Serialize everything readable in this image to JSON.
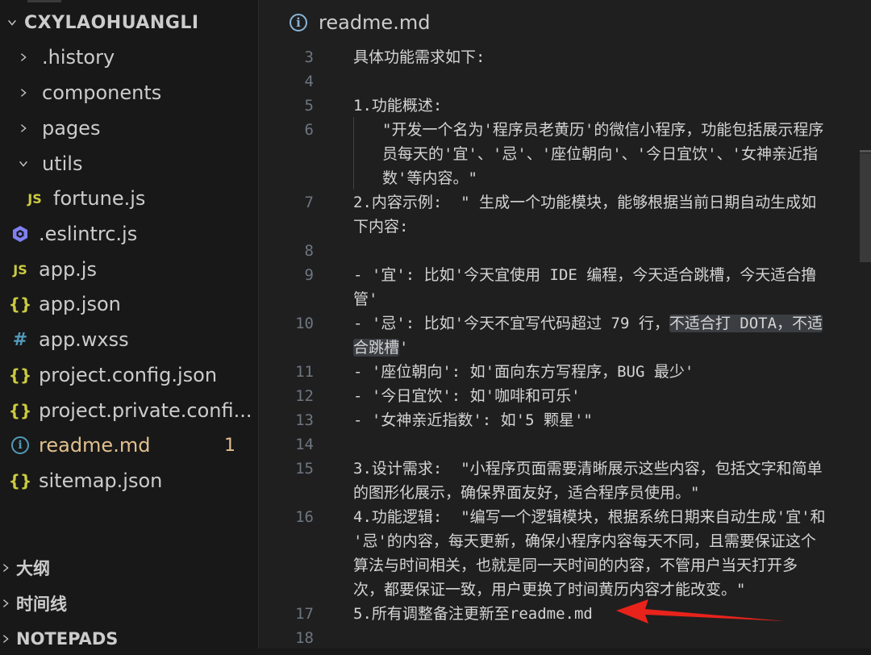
{
  "explorer": {
    "root": "CXYLAOHUANGLI",
    "items": [
      {
        "type": "folder",
        "label": ".history",
        "expanded": false
      },
      {
        "type": "folder",
        "label": "components",
        "expanded": false
      },
      {
        "type": "folder",
        "label": "pages",
        "expanded": false
      },
      {
        "type": "folder",
        "label": "utils",
        "expanded": true
      },
      {
        "type": "js",
        "label": "fortune.js"
      },
      {
        "type": "eslint",
        "label": ".eslintrc.js"
      },
      {
        "type": "js",
        "label": "app.js"
      },
      {
        "type": "json",
        "label": "app.json"
      },
      {
        "type": "css",
        "label": "app.wxss"
      },
      {
        "type": "json",
        "label": "project.config.json"
      },
      {
        "type": "json",
        "label": "project.private.confi..."
      },
      {
        "type": "info",
        "label": "readme.md",
        "badge": "1"
      },
      {
        "type": "json",
        "label": "sitemap.json"
      }
    ],
    "sections": [
      "大纲",
      "时间线",
      "NOTEPADS"
    ],
    "icons": {
      "js": "JS",
      "json": "{}",
      "css": "#",
      "info": "i"
    }
  },
  "editor": {
    "tab_title": "readme.md",
    "lines": [
      {
        "n": "3",
        "text": "具体功能需求如下:"
      },
      {
        "n": "4",
        "text": ""
      },
      {
        "n": "5",
        "text": "1.功能概述:"
      },
      {
        "n": "6",
        "text": "\"开发一个名为'程序员老黄历'的微信小程序，功能包括展示程序"
      },
      {
        "n": "",
        "text": "员每天的'宜'、'忌'、'座位朝向'、'今日宜饮'、'女神亲近指"
      },
      {
        "n": "",
        "text": "数'等内容。\""
      },
      {
        "n": "7",
        "text": "2.内容示例:  \" 生成一个功能模块，能够根据当前日期自动生成如"
      },
      {
        "n": "",
        "text": "下内容:"
      },
      {
        "n": "8",
        "text": ""
      },
      {
        "n": "9",
        "text": "- '宜': 比如'今天宜使用 IDE 编程，今天适合跳槽，今天适合撸"
      },
      {
        "n": "",
        "text": "管'"
      },
      {
        "n": "10",
        "text": "- '忌': 比如'今天不宜写代码超过 79 行，不适合打 DOTA，不适"
      },
      {
        "n": "",
        "text": "合跳槽'"
      },
      {
        "n": "11",
        "text": "- '座位朝向': 如'面向东方写程序，BUG 最少'"
      },
      {
        "n": "12",
        "text": "- '今日宜饮': 如'咖啡和可乐'"
      },
      {
        "n": "13",
        "text": "- '女神亲近指数': 如'5 颗星'\""
      },
      {
        "n": "14",
        "text": ""
      },
      {
        "n": "15",
        "text": "3.设计需求:  \"小程序页面需要清晰展示这些内容，包括文字和简单"
      },
      {
        "n": "",
        "text": "的图形化展示，确保界面友好，适合程序员使用。\""
      },
      {
        "n": "16",
        "text": "4.功能逻辑:  \"编写一个逻辑模块，根据系统日期来自动生成'宜'和"
      },
      {
        "n": "",
        "text": "'忌'的内容，每天更新，确保小程序内容每天不同，且需要保证这个"
      },
      {
        "n": "",
        "text": "算法与时间相关，也就是同一天时间的内容，不管用户当天打开多"
      },
      {
        "n": "",
        "text": "次，都要保证一致，用户更换了时间黄历内容才能改变。\""
      },
      {
        "n": "17",
        "text": "5.所有调整备注更新至readme.md"
      },
      {
        "n": "18",
        "text": ""
      }
    ]
  },
  "colors": {
    "arrow": "#e8231b",
    "badge": "#e2c08d"
  }
}
